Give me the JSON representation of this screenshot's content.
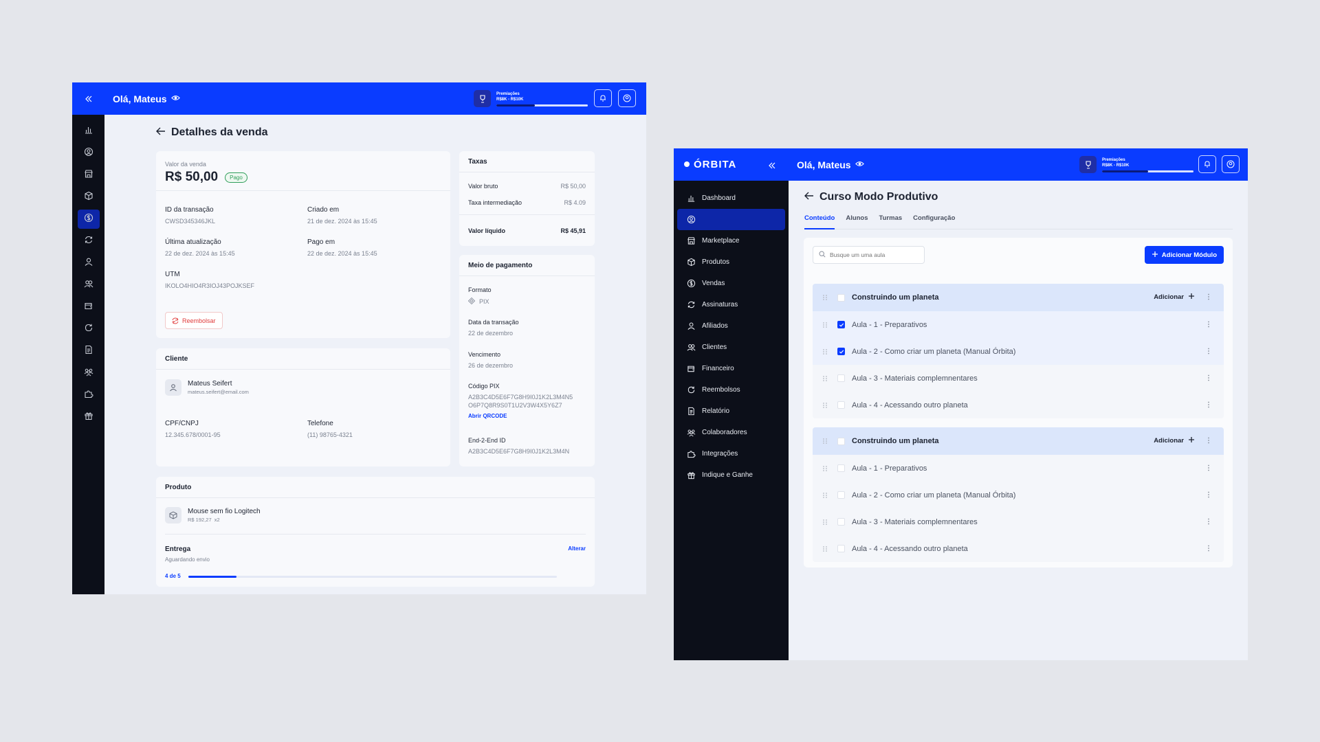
{
  "left": {
    "greeting": "Olá, Mateus",
    "premiacoes_label": "Premiações",
    "premiacoes_range": "R$8K - R$10K",
    "premiacoes_progress": 0.42,
    "page_title": "Detalhes da venda",
    "sale": {
      "value_label": "Valor da venda",
      "value": "R$ 50,00",
      "status": "Pago",
      "transaction_id_label": "ID da transação",
      "transaction_id": "CWSD345346JKL",
      "created_label": "Criado em",
      "created": "21 de dez. 2024 às 15:45",
      "updated_label": "Última atualização",
      "updated": "22 de dez. 2024 às 15:45",
      "paid_label": "Pago em",
      "paid": "22 de dez. 2024 às 15:45",
      "utm_label": "UTM",
      "utm": "IKOLO4HIO4R3IOJ43POJKSEF",
      "refund_button": "Reembolsar"
    },
    "fees": {
      "title": "Taxas",
      "gross_label": "Valor bruto",
      "gross": "R$ 50,00",
      "fee_label": "Taxa intermediação",
      "fee": "R$ 4.09",
      "net_label": "Valor líquido",
      "net": "R$ 45,91"
    },
    "payment": {
      "title": "Meio de pagamento",
      "format_label": "Formato",
      "format": "PIX",
      "date_label": "Data da transação",
      "date": "22 de dezembro",
      "due_label": "Vencimento",
      "due": "26 de dezembro",
      "pix_label": "Código PIX",
      "pix_line1": "A2B3C4D5E6F7G8H9I0J1K2L3M4N5",
      "pix_line2": "O6P7Q8R9S0T1U2V3W4X5Y6Z7",
      "qr_link": "Abrir QRCODE",
      "e2e_label": "End-2-End ID",
      "e2e": "A2B3C4D5E6F7G8H9I0J1K2L3M4N"
    },
    "client": {
      "title": "Cliente",
      "name": "Mateus Seifert",
      "email": "mateus.seifert@email.com",
      "doc_label": "CPF/CNPJ",
      "doc": "12.345.678/0001-95",
      "phone_label": "Telefone",
      "phone": "(11) 98765-4321"
    },
    "product": {
      "title": "Produto",
      "name": "Mouse sem fio Logitech",
      "price": "R$ 192,27",
      "qty": "x2",
      "delivery_label": "Entrega",
      "delivery_status": "Aguardando envio",
      "change_link": "Alterar",
      "progress_text": "4 de 5",
      "progress": 0.13
    }
  },
  "right": {
    "logo": "ÓRBITA",
    "greeting": "Olá, Mateus",
    "premiacoes_label": "Premiações",
    "premiacoes_range": "R$8K - R$10K",
    "premiacoes_progress": 0.5,
    "nav": [
      {
        "label": "Dashboard",
        "icon": "chart-icon"
      },
      {
        "label": "",
        "icon": "user-circle-icon"
      },
      {
        "label": "Marketplace",
        "icon": "store-icon"
      },
      {
        "label": "Produtos",
        "icon": "box-icon"
      },
      {
        "label": "Vendas",
        "icon": "dollar-icon"
      },
      {
        "label": "Assinaturas",
        "icon": "refresh-icon"
      },
      {
        "label": "Afiliados",
        "icon": "user-icon"
      },
      {
        "label": "Clientes",
        "icon": "users-icon"
      },
      {
        "label": "Financeiro",
        "icon": "wallet-icon"
      },
      {
        "label": "Reembolsos",
        "icon": "rotate-icon"
      },
      {
        "label": "Relatório",
        "icon": "report-icon"
      },
      {
        "label": "Colaboradores",
        "icon": "team-icon"
      },
      {
        "label": "Integrações",
        "icon": "puzzle-icon"
      },
      {
        "label": "Indique e Ganhe",
        "icon": "gift-icon"
      }
    ],
    "course_title": "Curso Modo Produtivo",
    "tabs": [
      "Conteúdo",
      "Alunos",
      "Turmas",
      "Configuração"
    ],
    "search_placeholder": "Busque um uma aula",
    "add_module": "Adicionar Módulo",
    "add_label": "Adicionar",
    "modules": [
      {
        "title": "Construindo um planeta",
        "lessons": [
          {
            "title": "Aula - 1 - Preparativos",
            "checked": true
          },
          {
            "title": "Aula - 2 - Como criar um planeta  (Manual Órbita)",
            "checked": true
          },
          {
            "title": "Aula - 3 - Materiais complemnentares",
            "checked": false
          },
          {
            "title": "Aula - 4 - Acessando outro planeta",
            "checked": false
          }
        ]
      },
      {
        "title": "Construindo um planeta",
        "lessons": [
          {
            "title": "Aula - 1 - Preparativos",
            "checked": false
          },
          {
            "title": "Aula - 2 - Como criar um planeta  (Manual Órbita)",
            "checked": false
          },
          {
            "title": "Aula - 3 - Materiais complemnentares",
            "checked": false
          },
          {
            "title": "Aula - 4 - Acessando outro planeta",
            "checked": false
          }
        ]
      }
    ]
  },
  "colors": {
    "brand": "#0a3cff",
    "sidebar": "#0c0f19",
    "success": "#2f9e5a",
    "danger": "#e03a3a"
  }
}
